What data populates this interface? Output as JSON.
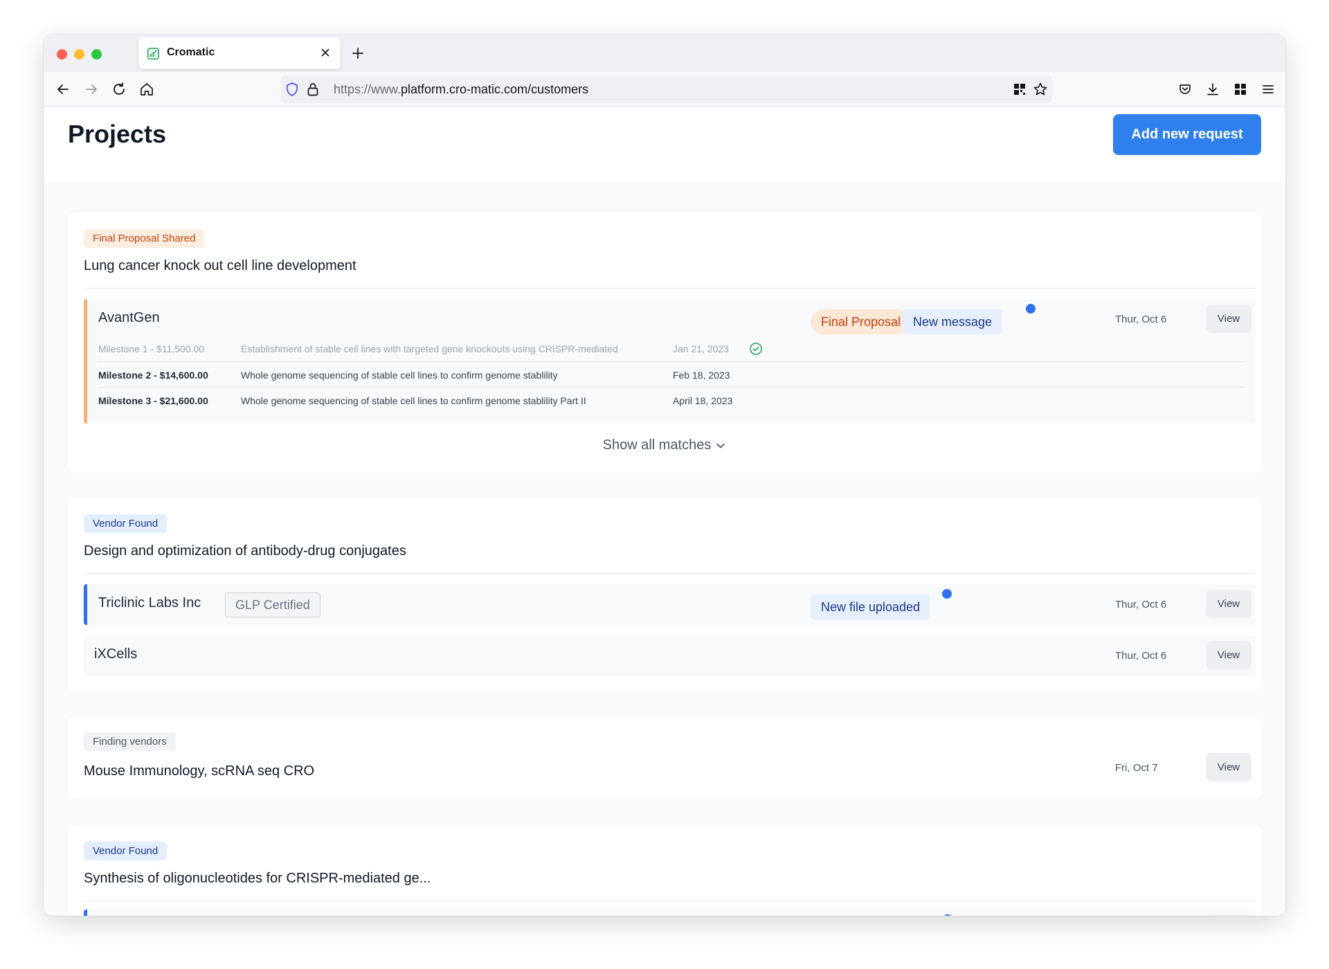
{
  "browser": {
    "tab_title": "Cromatic",
    "url_prefix": "https://www.",
    "url_main": "platform.cro-matic.com/customers"
  },
  "header": {
    "title": "Projects",
    "add_button": "Add new request"
  },
  "projects": [
    {
      "status": "Final Proposal Shared",
      "title": "Lung cancer knock out cell line development",
      "vendors": [
        {
          "name": "AvantGen",
          "pills": [
            "Final Proposal",
            "New message"
          ],
          "date": "Thur, Oct 6",
          "view": "View",
          "milestones": [
            {
              "label": "Milestone 1 - $11,500.00",
              "description": "Establishment of stable cell lines with targeted gene knockouts using CRISPR-mediated",
              "date": "Jan 21, 2023"
            },
            {
              "label": "Milestone 2 - $14,600.00",
              "description": "Whole genome sequencing of stable cell lines to confirm genome stablility",
              "date": "Feb 18, 2023"
            },
            {
              "label": "Milestone 3 - $21,600.00",
              "description": "Whole genome sequencing of stable cell lines to confirm genome stablility Part II",
              "date": "April 18, 2023"
            }
          ]
        }
      ],
      "show_all": "Show all matches"
    },
    {
      "status": "Vendor Found",
      "title": "Design and optimization of antibody-drug conjugates",
      "vendors": [
        {
          "name": "Triclinic Labs Inc",
          "certification": "GLP Certified",
          "pill": "New file uploaded",
          "date": "Thur, Oct 6",
          "view": "View"
        },
        {
          "name": "iXCells",
          "date": "Thur, Oct 6",
          "view": "View"
        }
      ]
    },
    {
      "status": "Finding vendors",
      "title": "Mouse Immunology, scRNA seq CRO",
      "date": "Fri, Oct 7",
      "view": "View"
    },
    {
      "status": "Vendor Found",
      "title": "Synthesis of oligonucleotides for CRISPR-mediated ge..."
    }
  ],
  "colors": {
    "accent": "#2f80ed",
    "proposal_orange": "#c2410c",
    "vendor_blue": "#2f6ff0"
  }
}
